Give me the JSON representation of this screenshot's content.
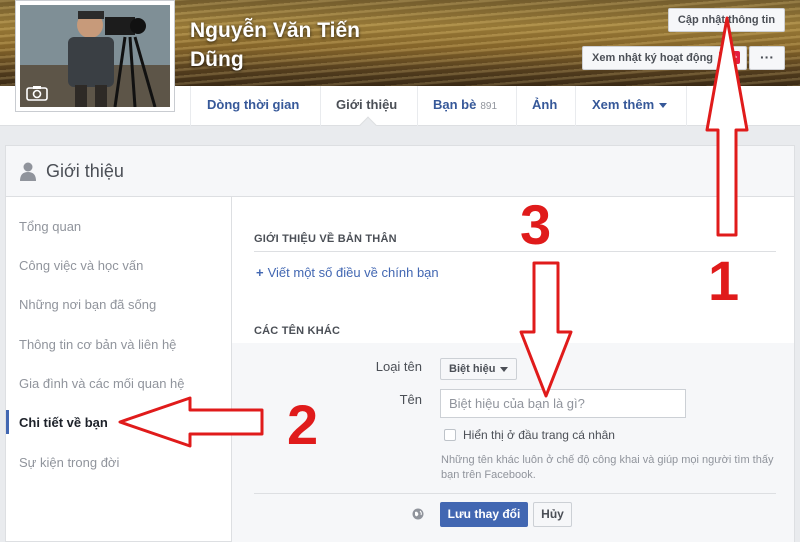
{
  "profile": {
    "name": "Nguyễn Văn Tiến Dũng",
    "update_button": "Cập nhật thông tin",
    "activity_button": "Xem nhật ký hoạt động",
    "activity_badge": "10+",
    "more_button": "···"
  },
  "nav": {
    "tabs": [
      {
        "label": "Dòng thời gian"
      },
      {
        "label": "Giới thiệu"
      },
      {
        "label": "Bạn bè",
        "count": "891"
      },
      {
        "label": "Ảnh"
      },
      {
        "label": "Xem thêm"
      }
    ],
    "active_tab": "Giới thiệu"
  },
  "about": {
    "title": "Giới thiệu",
    "left_nav": [
      "Tổng quan",
      "Công việc và học vấn",
      "Những nơi bạn đã sống",
      "Thông tin cơ bản và liên hệ",
      "Gia đình và các mối quan hệ",
      "Chi tiết về bạn",
      "Sự kiện trong đời"
    ],
    "active_item": "Chi tiết về bạn",
    "section_about_self": "Giới thiệu về bản thân",
    "add_about_link": "Viết một số điều về chính bạn",
    "section_other_names": "Các tên khác",
    "form": {
      "type_label": "Loại tên",
      "type_value": "Biệt hiệu",
      "name_label": "Tên",
      "name_placeholder": "Biệt hiệu của bạn là gì?",
      "checkbox_label": "Hiển thị ở đầu trang cá nhân",
      "help_text": "Những tên khác luôn ở chế độ công khai và giúp mọi người tìm thấy bạn trên Facebook.",
      "save_button": "Lưu thay đổi",
      "cancel_button": "Hủy"
    }
  },
  "annotations": {
    "step1": "1",
    "step2": "2",
    "step3": "3"
  },
  "colors": {
    "accent": "#4267b2",
    "link": "#365899",
    "annotation": "#e01b1b"
  }
}
